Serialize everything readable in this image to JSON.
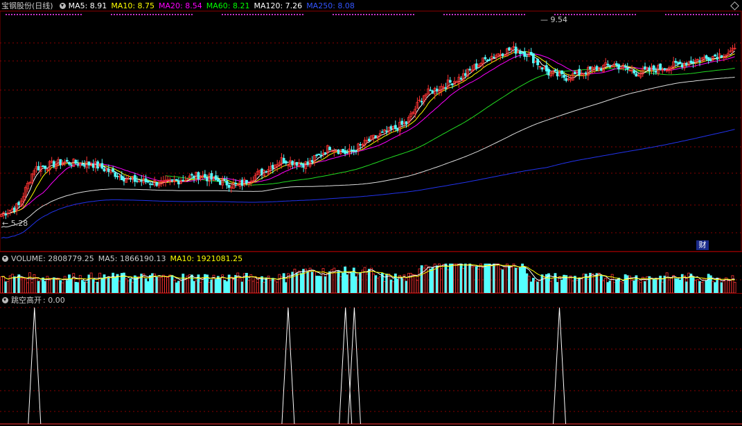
{
  "price_panel": {
    "title": "宝钢股份(日线)",
    "ma_labels": [
      {
        "text": "MA5: 8.91",
        "color": "#ffffff"
      },
      {
        "text": "MA10: 8.75",
        "color": "#ffff00"
      },
      {
        "text": "MA20: 8.54",
        "color": "#ff00ff"
      },
      {
        "text": "MA60: 8.21",
        "color": "#00ff00"
      },
      {
        "text": "MA120: 7.26",
        "color": "#ffffff"
      },
      {
        "text": "MA250: 8.08",
        "color": "#3355ff"
      }
    ],
    "high_label": "9.54",
    "low_label": "5.28",
    "finance_badge": "财"
  },
  "volume_panel": {
    "label": "VOLUME: 2808779.25",
    "ma5": "MA5: 1866190.13",
    "ma10": "MA10: 1921081.25"
  },
  "indicator_panel": {
    "label": "跳空高开",
    "value": ": 0.00"
  },
  "colors": {
    "up": "#ff3333",
    "down": "#54ffff",
    "grid": "#8b0000"
  },
  "chart_data": {
    "type": "candlestick",
    "high": 9.54,
    "low": 5.28,
    "gap_up_spikes_at_candle_index": [
      15,
      130,
      156,
      160,
      253
    ]
  }
}
